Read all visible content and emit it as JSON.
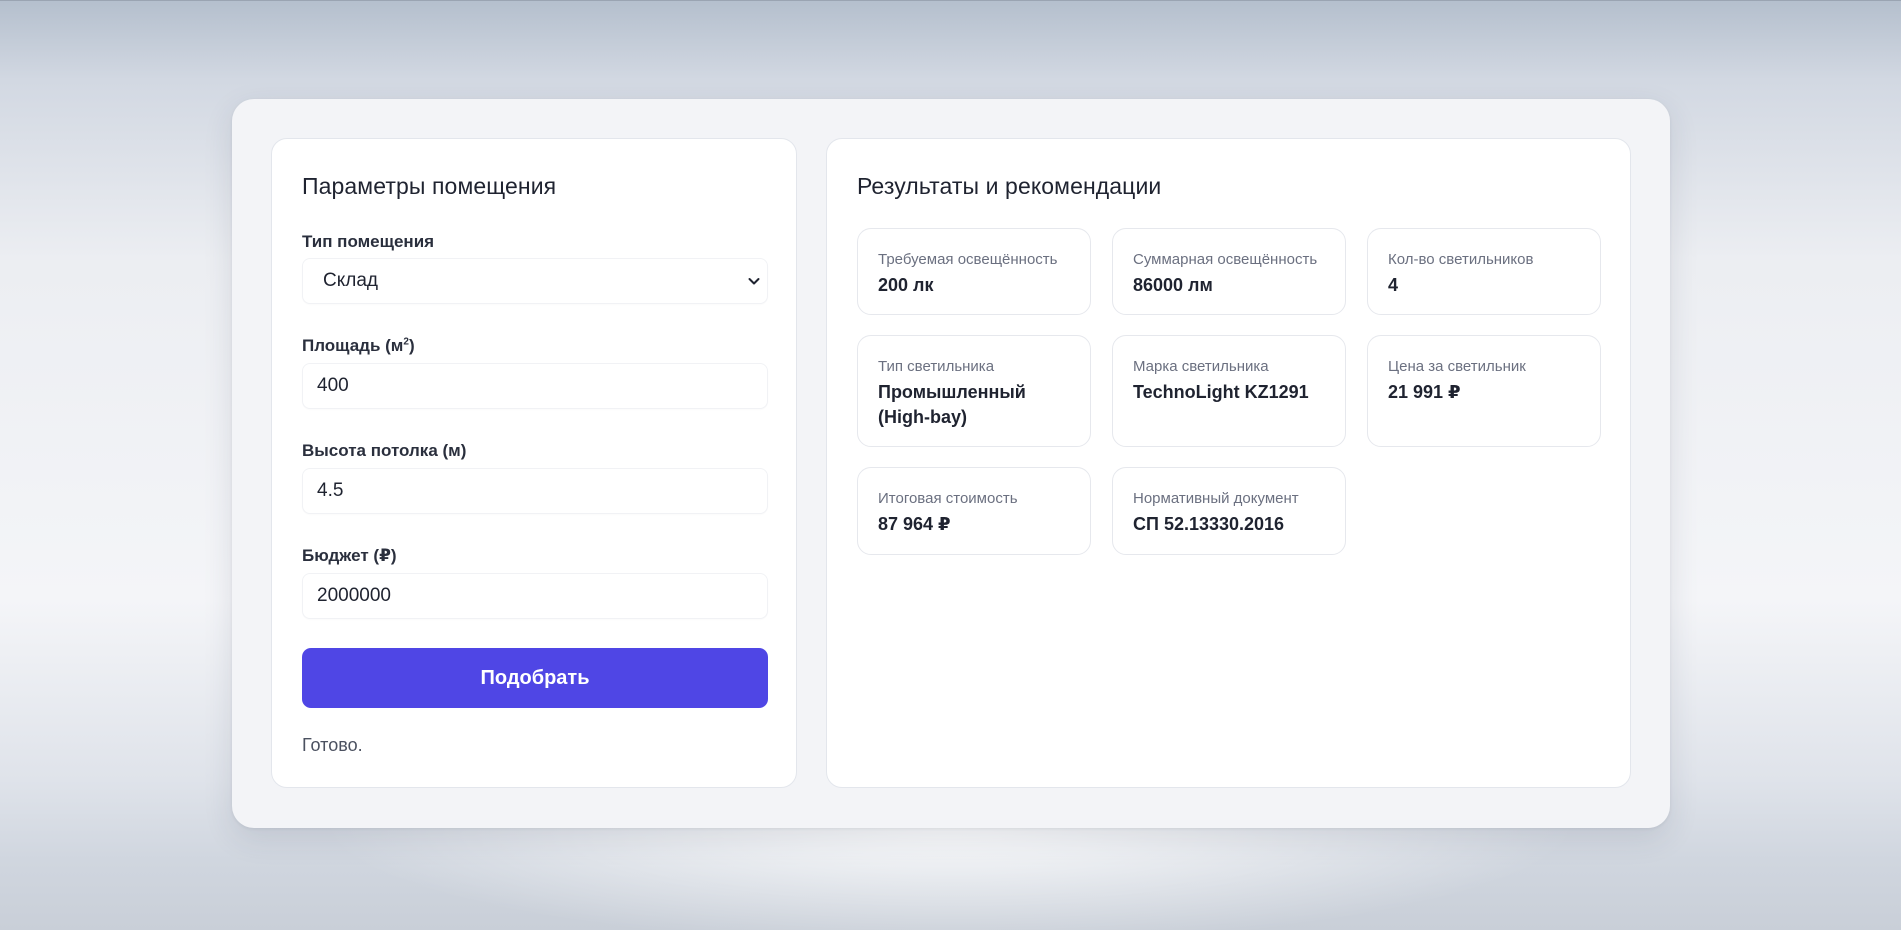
{
  "left_panel": {
    "title": "Параметры помещения",
    "room_type": {
      "label": "Тип помещения",
      "value": "Склад"
    },
    "area": {
      "label_prefix": "Площадь (м",
      "label_sup": "2",
      "label_suffix": ")",
      "value": "400"
    },
    "ceiling_height": {
      "label": "Высота потолка (м)",
      "value": "4.5"
    },
    "budget": {
      "label": "Бюджет (₽)",
      "value": "2000000"
    },
    "submit_label": "Подобрать",
    "status": "Готово."
  },
  "right_panel": {
    "title": "Результаты и рекомендации",
    "cards": [
      {
        "label": "Требуемая освещённость",
        "value": "200 лк"
      },
      {
        "label": "Суммарная освещённость",
        "value": "86000 лм"
      },
      {
        "label": "Кол-во светильников",
        "value": "4"
      },
      {
        "label": "Тип светильника",
        "value": "Промышленный (High-bay)"
      },
      {
        "label": "Марка светильника",
        "value": "TechnoLight KZ1291"
      },
      {
        "label": "Цена за светильник",
        "value": "21 991 ₽"
      },
      {
        "label": "Итоговая стоимость",
        "value": "87 964 ₽"
      },
      {
        "label": "Нормативный документ",
        "value": "СП 52.13330.2016"
      }
    ]
  },
  "icons": {
    "select_arrow": "chevron-down-icon"
  },
  "colors": {
    "accent": "#4f46e5",
    "panel": "#ffffff",
    "shell": "#f3f4f7"
  }
}
